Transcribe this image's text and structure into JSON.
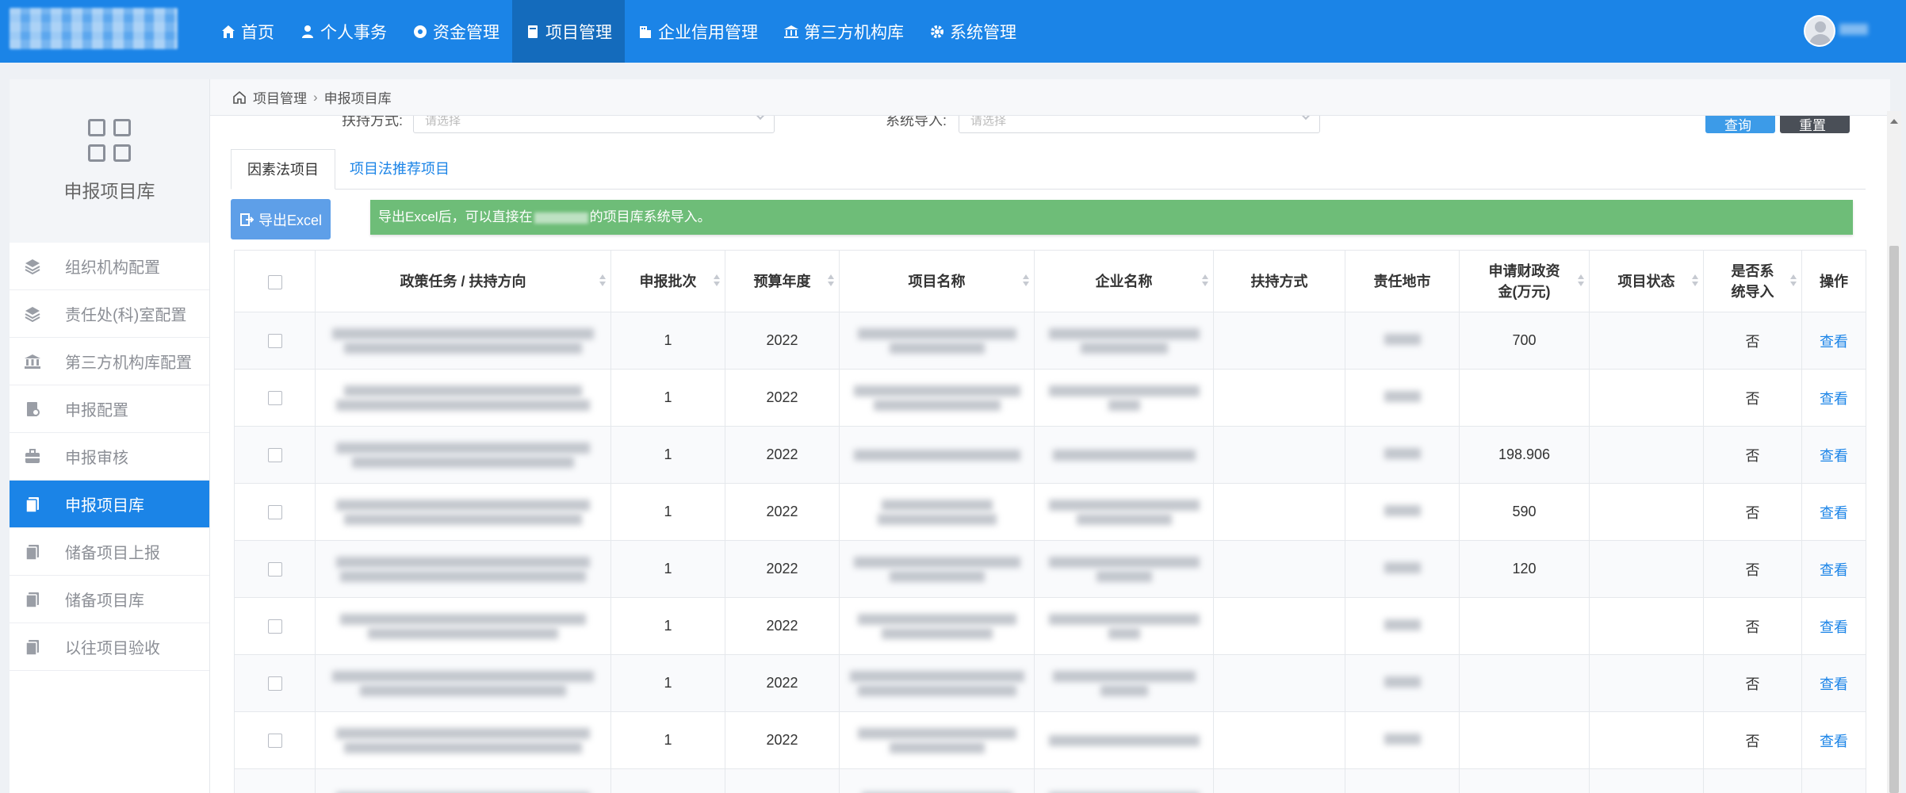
{
  "nav": {
    "items": [
      {
        "label": "首页",
        "icon": "home-icon"
      },
      {
        "label": "个人事务",
        "icon": "user-icon"
      },
      {
        "label": "资金管理",
        "icon": "coin-icon"
      },
      {
        "label": "项目管理",
        "icon": "book-icon",
        "active": true
      },
      {
        "label": "企业信用管理",
        "icon": "building-icon"
      },
      {
        "label": "第三方机构库",
        "icon": "bank-icon"
      },
      {
        "label": "系统管理",
        "icon": "gear-icon"
      }
    ]
  },
  "sidebar": {
    "title": "申报项目库",
    "items": [
      {
        "label": "组织机构配置"
      },
      {
        "label": "责任处(科)室配置"
      },
      {
        "label": "第三方机构库配置"
      },
      {
        "label": "申报配置"
      },
      {
        "label": "申报审核"
      },
      {
        "label": "申报项目库",
        "active": true
      },
      {
        "label": "储备项目上报"
      },
      {
        "label": "储备项目库"
      },
      {
        "label": "以往项目验收"
      }
    ]
  },
  "breadcrumb": {
    "root": "项目管理",
    "current": "申报项目库"
  },
  "filters": {
    "support_label": "扶持方式:",
    "support_placeholder": "请选择",
    "import_label": "系统导入:",
    "import_placeholder": "请选择",
    "query_button": "查询",
    "reset_button": "重置"
  },
  "tabs": [
    {
      "label": "因素法项目",
      "active": true
    },
    {
      "label": "项目法推荐项目"
    }
  ],
  "export_button": "导出Excel",
  "notice": {
    "prefix": "导出Excel后，可以直接在",
    "suffix": "的项目库系统导入。"
  },
  "table": {
    "headers": [
      "政策任务 / 扶持方向",
      "申报批次",
      "预算年度",
      "项目名称",
      "企业名称",
      "扶持方式",
      "责任地市",
      "申请财政资金(万元)",
      "项目状态",
      "是否系统导入",
      "操作"
    ],
    "rows": [
      {
        "batch": "1",
        "year": "2022",
        "amount": "700",
        "imported": "否",
        "action": "查看"
      },
      {
        "batch": "1",
        "year": "2022",
        "amount": "",
        "imported": "否",
        "action": "查看"
      },
      {
        "batch": "1",
        "year": "2022",
        "amount": "198.906",
        "imported": "否",
        "action": "查看"
      },
      {
        "batch": "1",
        "year": "2022",
        "amount": "590",
        "imported": "否",
        "action": "查看"
      },
      {
        "batch": "1",
        "year": "2022",
        "amount": "120",
        "imported": "否",
        "action": "查看"
      },
      {
        "batch": "1",
        "year": "2022",
        "amount": "",
        "imported": "否",
        "action": "查看"
      },
      {
        "batch": "1",
        "year": "2022",
        "amount": "",
        "imported": "否",
        "action": "查看"
      },
      {
        "batch": "1",
        "year": "2022",
        "amount": "",
        "imported": "否",
        "action": "查看"
      }
    ]
  },
  "colors": {
    "brand": "#1b84e7",
    "nav_active": "#146bbc",
    "notice": "#6ebd78"
  }
}
